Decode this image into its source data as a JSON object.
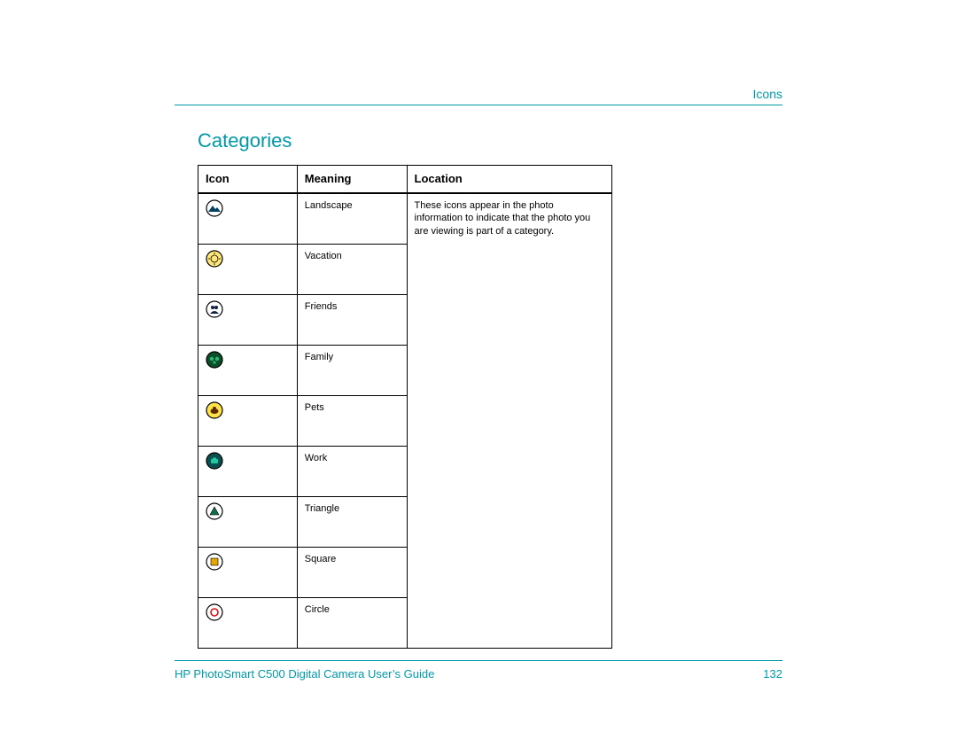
{
  "header": {
    "section_label": "Icons"
  },
  "section": {
    "title": "Categories"
  },
  "table": {
    "headers": {
      "icon": "Icon",
      "meaning": "Meaning",
      "location": "Location"
    },
    "location_text": "These icons appear in the photo information to indicate that the photo you are viewing is part of a category.",
    "rows": [
      {
        "icon_name": "landscape-icon",
        "meaning": "Landscape"
      },
      {
        "icon_name": "vacation-icon",
        "meaning": "Vacation"
      },
      {
        "icon_name": "friends-icon",
        "meaning": "Friends"
      },
      {
        "icon_name": "family-icon",
        "meaning": "Family"
      },
      {
        "icon_name": "pets-icon",
        "meaning": "Pets"
      },
      {
        "icon_name": "work-icon",
        "meaning": "Work"
      },
      {
        "icon_name": "triangle-icon",
        "meaning": "Triangle"
      },
      {
        "icon_name": "square-icon",
        "meaning": "Square"
      },
      {
        "icon_name": "circle-icon",
        "meaning": "Circle"
      }
    ]
  },
  "footer": {
    "guide_title": "HP PhotoSmart C500 Digital Camera User’s Guide",
    "page_number": "132"
  }
}
